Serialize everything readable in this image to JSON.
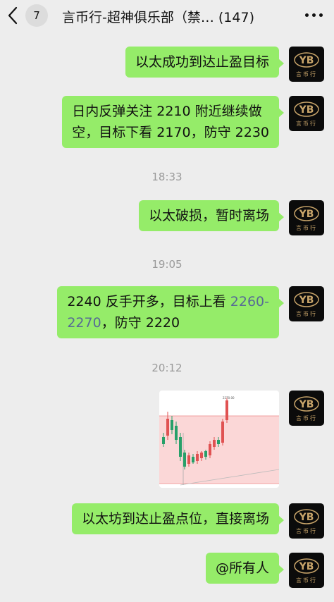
{
  "header": {
    "back_count": "7",
    "title": "言币行-超神俱乐部（禁…  (147)"
  },
  "avatar_text": "言币行",
  "messages": [
    {
      "type": "text",
      "text": "以太成功到达止盈目标"
    },
    {
      "type": "text",
      "line1": "日内反弹关注 2210 附近继续做",
      "line2": "空，目标下看 2170，防守 2230"
    },
    {
      "type": "time",
      "text": "18:33"
    },
    {
      "type": "text",
      "text": "以太破损，暂时离场"
    },
    {
      "type": "time",
      "text": "19:05"
    },
    {
      "type": "text",
      "line1_a": "2240 反手开多，目标上看 ",
      "line1_link": "2260-",
      "line2_link": "2270",
      "line2_b": "，防守 2220"
    },
    {
      "type": "time",
      "text": "20:12"
    },
    {
      "type": "image",
      "label": "2270.00"
    },
    {
      "type": "text",
      "text": "以太坊到达止盈点位，直接离场"
    },
    {
      "type": "text",
      "text": "@所有人"
    }
  ],
  "colors": {
    "bubble": "#95ec69",
    "link": "#576b95",
    "background": "#ededed",
    "candle_up": "#e05252",
    "candle_down": "#27a069"
  },
  "icons": [
    "back-chevron-icon",
    "more-dots-icon"
  ]
}
